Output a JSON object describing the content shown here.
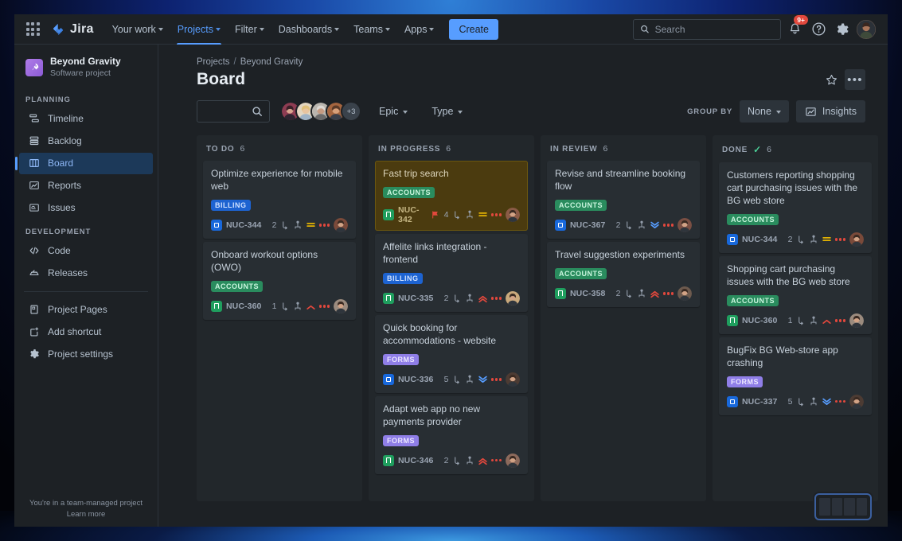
{
  "topnav": {
    "apps_icon": "apps-grid-icon",
    "brand": "Jira",
    "items": [
      {
        "label": "Your work",
        "has_caret": true,
        "active": false
      },
      {
        "label": "Projects",
        "has_caret": true,
        "active": true
      },
      {
        "label": "Filter",
        "has_caret": true,
        "active": false
      },
      {
        "label": "Dashboards",
        "has_caret": true,
        "active": false
      },
      {
        "label": "Teams",
        "has_caret": true,
        "active": false
      },
      {
        "label": "Apps",
        "has_caret": true,
        "active": false
      }
    ],
    "create_label": "Create",
    "search_placeholder": "Search",
    "search_value": "",
    "notifications_badge": "9+",
    "accent": "#579dff"
  },
  "sidebar": {
    "project_name": "Beyond Gravity",
    "project_type": "Software project",
    "project_avatar_icon": "rocket-icon",
    "sections": [
      {
        "label": "PLANNING",
        "items": [
          {
            "label": "Timeline",
            "icon": "timeline-icon",
            "selected": false
          },
          {
            "label": "Backlog",
            "icon": "backlog-icon",
            "selected": false
          },
          {
            "label": "Board",
            "icon": "board-icon",
            "selected": true
          },
          {
            "label": "Reports",
            "icon": "reports-icon",
            "selected": false
          },
          {
            "label": "Issues",
            "icon": "issues-icon",
            "selected": false
          }
        ]
      },
      {
        "label": "DEVELOPMENT",
        "items": [
          {
            "label": "Code",
            "icon": "code-icon",
            "selected": false
          },
          {
            "label": "Releases",
            "icon": "releases-icon",
            "selected": false
          }
        ]
      }
    ],
    "extra_items": [
      {
        "label": "Project Pages",
        "icon": "pages-icon"
      },
      {
        "label": "Add shortcut",
        "icon": "add-shortcut-icon"
      },
      {
        "label": "Project settings",
        "icon": "settings-gear-icon"
      }
    ],
    "footer_line1": "You're in a team-managed project",
    "footer_line2": "Learn more"
  },
  "header": {
    "breadcrumb": [
      "Projects",
      "Beyond Gravity"
    ],
    "breadcrumb_separator": "/",
    "title": "Board",
    "star_icon": "star-icon",
    "more_icon": "more-actions-icon"
  },
  "toolbar": {
    "search_value": "",
    "search_icon": "search-icon",
    "avatars": [
      "#7d4d52",
      "#c8a878",
      "#8e8a86",
      "#a5653f"
    ],
    "avatar_overflow": "+3",
    "filters": [
      {
        "label": "Epic"
      },
      {
        "label": "Type"
      }
    ],
    "group_by_label": "GROUP BY",
    "group_by_value": "None",
    "insights_label": "Insights",
    "insights_icon": "insights-chart-icon"
  },
  "board": {
    "columns": [
      {
        "name": "TO DO",
        "count": "6",
        "done_check": false,
        "cards": [
          {
            "title": "Optimize experience for mobile web",
            "epic": "BILLING",
            "key": "NUC-344",
            "type": "task",
            "count": "2",
            "priority": "medium",
            "flagged": false,
            "avatar": "#7a4a3a",
            "selected": false
          },
          {
            "title": "Onboard workout options (OWO)",
            "epic": "ACCOUNTS",
            "key": "NUC-360",
            "type": "story",
            "count": "1",
            "priority": "high",
            "flagged": false,
            "avatar": "#9b8b7e",
            "selected": false
          }
        ]
      },
      {
        "name": "IN PROGRESS",
        "count": "6",
        "done_check": false,
        "cards": [
          {
            "title": "Fast trip search",
            "epic": "ACCOUNTS",
            "key": "NUC-342",
            "type": "story",
            "count": "4",
            "priority": "medium",
            "flagged": true,
            "avatar": "#8a5b46",
            "selected": true
          },
          {
            "title": "Affelite links integration - frontend",
            "epic": "BILLING",
            "key": "NUC-335",
            "type": "story",
            "count": "2",
            "priority": "highest",
            "flagged": false,
            "avatar": "#c9a97c",
            "selected": false
          },
          {
            "title": "Quick booking for accommodations - website",
            "epic": "FORMS",
            "key": "NUC-336",
            "type": "task",
            "count": "5",
            "priority": "low",
            "flagged": false,
            "avatar": "#4c3b33",
            "selected": false
          },
          {
            "title": "Adapt web app no new payments provider",
            "epic": "FORMS",
            "key": "NUC-346",
            "type": "story",
            "count": "2",
            "priority": "highest",
            "flagged": false,
            "avatar": "#8c6a5c",
            "selected": false
          }
        ]
      },
      {
        "name": "IN REVIEW",
        "count": "6",
        "done_check": false,
        "cards": [
          {
            "title": "Revise and streamline booking flow",
            "epic": "ACCOUNTS",
            "key": "NUC-367",
            "type": "task",
            "count": "2",
            "priority": "low",
            "flagged": false,
            "avatar": "#7a4f43",
            "selected": false
          },
          {
            "title": "Travel suggestion experiments",
            "epic": "ACCOUNTS",
            "key": "NUC-358",
            "type": "story",
            "count": "2",
            "priority": "highest",
            "flagged": false,
            "avatar": "#6d5a4e",
            "selected": false
          }
        ]
      },
      {
        "name": "DONE",
        "count": "6",
        "done_check": true,
        "cards": [
          {
            "title": "Customers reporting shopping cart purchasing issues with the BG web store",
            "epic": "ACCOUNTS",
            "key": "NUC-344",
            "type": "task",
            "count": "2",
            "priority": "medium",
            "flagged": false,
            "avatar": "#7a4a3a",
            "selected": false
          },
          {
            "title": "Shopping cart purchasing issues with the BG web store",
            "epic": "ACCOUNTS",
            "key": "NUC-360",
            "type": "story",
            "count": "1",
            "priority": "high",
            "flagged": false,
            "avatar": "#9b8b7e",
            "selected": false
          },
          {
            "title": "BugFix BG Web-store app crashing",
            "epic": "FORMS",
            "key": "NUC-337",
            "type": "task",
            "count": "5",
            "priority": "low",
            "flagged": false,
            "avatar": "#4c3b33",
            "selected": false
          }
        ]
      }
    ]
  },
  "minimap": {
    "name": "board-minimap"
  }
}
